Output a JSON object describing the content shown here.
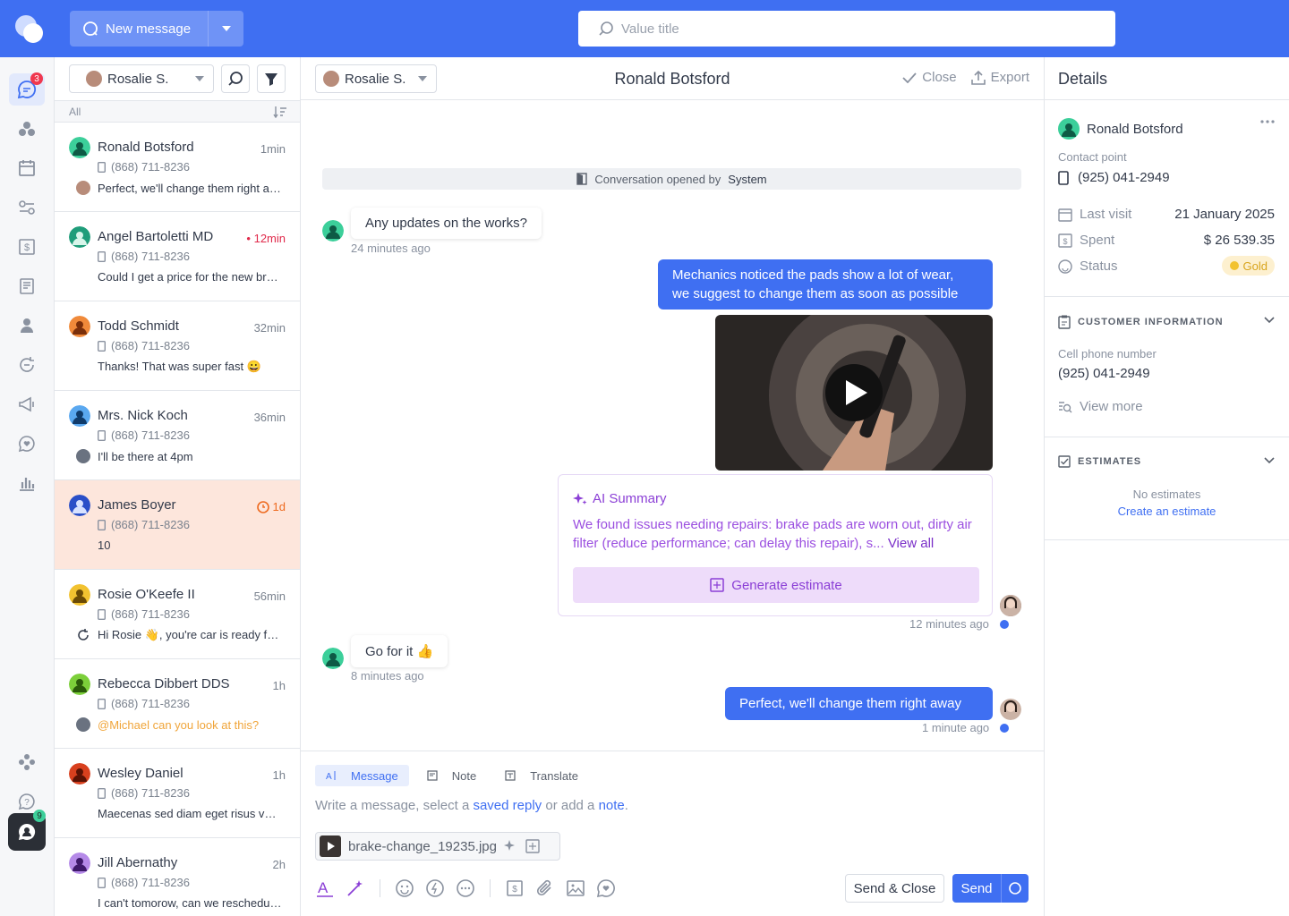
{
  "topbar": {
    "new_message_label": "New message",
    "search_placeholder": "Value title"
  },
  "rail": {
    "messages_badge": "3",
    "chat_badge": "9"
  },
  "list": {
    "agent_filter": "Rosalie S.",
    "filter_label": "All",
    "conversations": [
      {
        "name": "Ronald Botsford",
        "time": "1min",
        "phone": "(868) 711-8236",
        "preview": "Perfect, we'll change them right away",
        "avatar_color": "#3ccf9a"
      },
      {
        "name": "Angel Bartoletti MD",
        "time": "• 12min",
        "phone": "(868) 711-8236",
        "preview": "Could I get a price for the new brakes?",
        "avatar_color": "#1f9d7a"
      },
      {
        "name": "Todd Schmidt",
        "time": "32min",
        "phone": "(868) 711-8236",
        "preview": "Thanks! That was super fast 😀",
        "avatar_color": "#f08a3a"
      },
      {
        "name": "Mrs. Nick Koch",
        "time": "36min",
        "phone": "(868) 711-8236",
        "preview": "I'll be there at 4pm",
        "avatar_color": "#5aa8f0"
      },
      {
        "name": "James Boyer",
        "time": "1d",
        "phone": "(868) 711-8236",
        "preview": "10",
        "avatar_color": "#2a4fc8"
      },
      {
        "name": "Rosie O'Keefe II",
        "time": "56min",
        "phone": "(868) 711-8236",
        "preview": "Hi Rosie 👋, you're car is ready for pickup",
        "avatar_color": "#f2c230"
      },
      {
        "name": "Rebecca Dibbert DDS",
        "time": "1h",
        "phone": "(868) 711-8236",
        "preview": "@Michael can you look at this?",
        "avatar_color": "#7ccf3a"
      },
      {
        "name": "Wesley Daniel",
        "time": "1h",
        "phone": "(868) 711-8236",
        "preview": "Maecenas sed diam eget risus varius",
        "avatar_color": "#d8401e"
      },
      {
        "name": "Jill Abernathy",
        "time": "2h",
        "phone": "(868) 711-8236",
        "preview": "I can't tomorow, can we reschedule?",
        "avatar_color": "#b58ae8"
      }
    ]
  },
  "chat": {
    "agent": "Rosalie S.",
    "title": "Ronald Botsford",
    "close_label": "Close",
    "export_label": "Export",
    "system_prefix": "Conversation opened by",
    "system_actor": "System",
    "messages": {
      "m1": {
        "text": "Any updates on the works?",
        "time": "24 minutes ago"
      },
      "m2": {
        "line1": "Mechanics noticed the pads show a lot of wear,",
        "line2": "we suggest to change them as soon as possible"
      },
      "ai_title": "AI Summary",
      "ai_text": "We found issues needing repairs: brake pads are worn out, dirty air filter (reduce performance; can delay this repair), s...",
      "ai_view_all": "View all",
      "ai_button": "Generate estimate",
      "m2_time": "12 minutes ago",
      "m3": {
        "text": "Go for it 👍",
        "time": "8 minutes ago"
      },
      "m4": {
        "text": "Perfect, we'll change them right away",
        "time": "1 minute ago"
      }
    }
  },
  "composer": {
    "tab_message": "Message",
    "tab_note": "Note",
    "tab_translate": "Translate",
    "ph_1": "Write a message, select a",
    "ph_link1": "saved reply",
    "ph_2": "or add a",
    "ph_link2": "note",
    "ph_3": ".",
    "attachment": "brake-change_19235.jpg",
    "send_close": "Send & Close",
    "send": "Send"
  },
  "details": {
    "title": "Details",
    "contact_name": "Ronald Botsford",
    "contact_point_label": "Contact point",
    "contact_point": "(925) 041-2949",
    "last_visit_label": "Last visit",
    "last_visit": "21 January 2025",
    "spent_label": "Spent",
    "spent": "$ 26 539.35",
    "status_label": "Status",
    "status": "Gold",
    "customer_info_heading": "CUSTOMER INFORMATION",
    "cell_label": "Cell phone number",
    "cell_value": "(925) 041-2949",
    "view_more": "View more",
    "estimates_heading": "ESTIMATES",
    "no_estimates": "No estimates",
    "create_estimate": "Create an estimate"
  },
  "colors": {
    "accent": "#3f6ff2",
    "selected_row": "#fde6dc",
    "ai_purple": "#8b3fd6",
    "unread_red": "#e0294a",
    "gold": "#d8a41c"
  }
}
